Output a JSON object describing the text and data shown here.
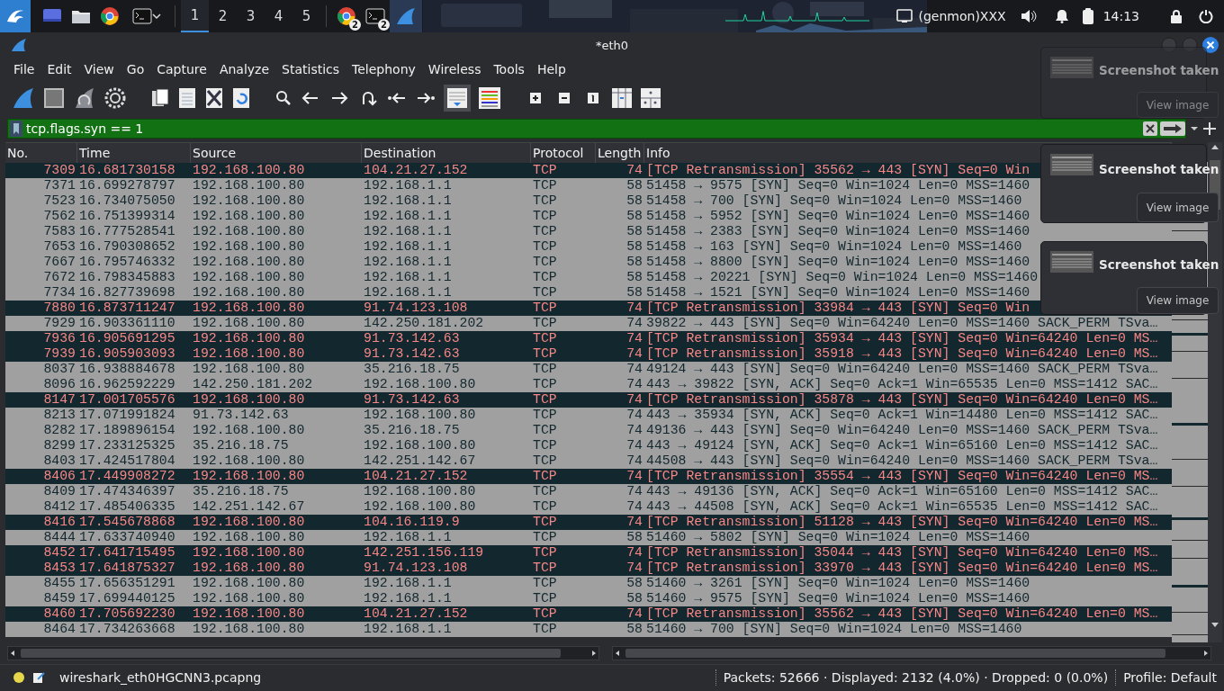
{
  "taskbar": {
    "workspaces": [
      {
        "label": "1",
        "selected": true
      },
      {
        "label": "2",
        "selected": false
      },
      {
        "label": "3",
        "selected": false
      },
      {
        "label": "4",
        "selected": false
      },
      {
        "label": "5",
        "selected": false
      }
    ],
    "app_badges": [
      "2",
      "2"
    ],
    "genmon": "(genmon)XXX",
    "clock": "14:13"
  },
  "window": {
    "title": "*eth0"
  },
  "menu": [
    "File",
    "Edit",
    "View",
    "Go",
    "Capture",
    "Analyze",
    "Statistics",
    "Telephony",
    "Wireless",
    "Tools",
    "Help"
  ],
  "filter": {
    "value": "tcp.flags.syn == 1"
  },
  "columns": [
    "No.",
    "Time",
    "Source",
    "Destination",
    "Protocol",
    "Length",
    "Info"
  ],
  "rows": [
    {
      "kind": "error",
      "cells": [
        "7309",
        "16.681730158",
        "192.168.100.80",
        "104.21.27.152",
        "TCP",
        "74",
        "[TCP Retransmission] 35562 → 443 [SYN] Seq=0 Win"
      ]
    },
    {
      "kind": "normal",
      "cells": [
        "7371",
        "16.699278797",
        "192.168.100.80",
        "192.168.1.1",
        "TCP",
        "58",
        "51458 → 9575 [SYN] Seq=0 Win=1024 Len=0 MSS=1460"
      ]
    },
    {
      "kind": "normal",
      "cells": [
        "7523",
        "16.734075050",
        "192.168.100.80",
        "192.168.1.1",
        "TCP",
        "58",
        "51458 → 700 [SYN] Seq=0 Win=1024 Len=0 MSS=1460"
      ]
    },
    {
      "kind": "normal",
      "cells": [
        "7562",
        "16.751399314",
        "192.168.100.80",
        "192.168.1.1",
        "TCP",
        "58",
        "51458 → 5952 [SYN] Seq=0 Win=1024 Len=0 MSS=1460"
      ]
    },
    {
      "kind": "normal",
      "cells": [
        "7583",
        "16.777528541",
        "192.168.100.80",
        "192.168.1.1",
        "TCP",
        "58",
        "51458 → 2383 [SYN] Seq=0 Win=1024 Len=0 MSS=1460"
      ]
    },
    {
      "kind": "normal",
      "cells": [
        "7653",
        "16.790308652",
        "192.168.100.80",
        "192.168.1.1",
        "TCP",
        "58",
        "51458 → 163 [SYN] Seq=0 Win=1024 Len=0 MSS=1460"
      ]
    },
    {
      "kind": "normal",
      "cells": [
        "7667",
        "16.795746332",
        "192.168.100.80",
        "192.168.1.1",
        "TCP",
        "58",
        "51458 → 8800 [SYN] Seq=0 Win=1024 Len=0 MSS=1460"
      ]
    },
    {
      "kind": "normal",
      "cells": [
        "7672",
        "16.798345883",
        "192.168.100.80",
        "192.168.1.1",
        "TCP",
        "58",
        "51458 → 20221 [SYN] Seq=0 Win=1024 Len=0 MSS=1460"
      ]
    },
    {
      "kind": "normal",
      "cells": [
        "7734",
        "16.827739698",
        "192.168.100.80",
        "192.168.1.1",
        "TCP",
        "58",
        "51458 → 1521 [SYN] Seq=0 Win=1024 Len=0 MSS=1460"
      ]
    },
    {
      "kind": "error",
      "cells": [
        "7880",
        "16.873711247",
        "192.168.100.80",
        "91.74.123.108",
        "TCP",
        "74",
        "[TCP Retransmission] 33984 → 443 [SYN] Seq=0 Win"
      ]
    },
    {
      "kind": "normal",
      "cells": [
        "7929",
        "16.903361110",
        "192.168.100.80",
        "142.250.181.202",
        "TCP",
        "74",
        "39822 → 443 [SYN] Seq=0 Win=64240 Len=0 MSS=1460 SACK_PERM TSva…"
      ]
    },
    {
      "kind": "error",
      "cells": [
        "7936",
        "16.905691295",
        "192.168.100.80",
        "91.73.142.63",
        "TCP",
        "74",
        "[TCP Retransmission] 35934 → 443 [SYN] Seq=0 Win=64240 Len=0 MS…"
      ]
    },
    {
      "kind": "error",
      "cells": [
        "7939",
        "16.905903093",
        "192.168.100.80",
        "91.73.142.63",
        "TCP",
        "74",
        "[TCP Retransmission] 35918 → 443 [SYN] Seq=0 Win=64240 Len=0 MS…"
      ]
    },
    {
      "kind": "normal",
      "cells": [
        "8037",
        "16.938884678",
        "192.168.100.80",
        "35.216.18.75",
        "TCP",
        "74",
        "49124 → 443 [SYN] Seq=0 Win=64240 Len=0 MSS=1460 SACK_PERM TSva…"
      ]
    },
    {
      "kind": "normal",
      "cells": [
        "8096",
        "16.962592229",
        "142.250.181.202",
        "192.168.100.80",
        "TCP",
        "74",
        "443 → 39822 [SYN, ACK] Seq=0 Ack=1 Win=65535 Len=0 MSS=1412 SAC…"
      ]
    },
    {
      "kind": "error",
      "cells": [
        "8147",
        "17.001705576",
        "192.168.100.80",
        "91.73.142.63",
        "TCP",
        "74",
        "[TCP Retransmission] 35878 → 443 [SYN] Seq=0 Win=64240 Len=0 MS…"
      ]
    },
    {
      "kind": "normal",
      "cells": [
        "8213",
        "17.071991824",
        "91.73.142.63",
        "192.168.100.80",
        "TCP",
        "74",
        "443 → 35934 [SYN, ACK] Seq=0 Ack=1 Win=14480 Len=0 MSS=1412 SAC…"
      ]
    },
    {
      "kind": "normal",
      "cells": [
        "8282",
        "17.189896154",
        "192.168.100.80",
        "35.216.18.75",
        "TCP",
        "74",
        "49136 → 443 [SYN] Seq=0 Win=64240 Len=0 MSS=1460 SACK_PERM TSva…"
      ]
    },
    {
      "kind": "normal",
      "cells": [
        "8299",
        "17.233125325",
        "35.216.18.75",
        "192.168.100.80",
        "TCP",
        "74",
        "443 → 49124 [SYN, ACK] Seq=0 Ack=1 Win=65160 Len=0 MSS=1412 SAC…"
      ]
    },
    {
      "kind": "normal",
      "cells": [
        "8403",
        "17.424517804",
        "192.168.100.80",
        "142.251.142.67",
        "TCP",
        "74",
        "44508 → 443 [SYN] Seq=0 Win=64240 Len=0 MSS=1460 SACK_PERM TSva…"
      ]
    },
    {
      "kind": "error",
      "cells": [
        "8406",
        "17.449908272",
        "192.168.100.80",
        "104.21.27.152",
        "TCP",
        "74",
        "[TCP Retransmission] 35554 → 443 [SYN] Seq=0 Win=64240 Len=0 MS…"
      ]
    },
    {
      "kind": "normal",
      "cells": [
        "8409",
        "17.474346397",
        "35.216.18.75",
        "192.168.100.80",
        "TCP",
        "74",
        "443 → 49136 [SYN, ACK] Seq=0 Ack=1 Win=65160 Len=0 MSS=1412 SAC…"
      ]
    },
    {
      "kind": "normal",
      "cells": [
        "8412",
        "17.485406335",
        "142.251.142.67",
        "192.168.100.80",
        "TCP",
        "74",
        "443 → 44508 [SYN, ACK] Seq=0 Ack=1 Win=65535 Len=0 MSS=1412 SAC…"
      ]
    },
    {
      "kind": "error",
      "cells": [
        "8416",
        "17.545678868",
        "192.168.100.80",
        "104.16.119.9",
        "TCP",
        "74",
        "[TCP Retransmission] 51128 → 443 [SYN] Seq=0 Win=64240 Len=0 MS…"
      ]
    },
    {
      "kind": "normal",
      "cells": [
        "8444",
        "17.633740940",
        "192.168.100.80",
        "192.168.1.1",
        "TCP",
        "58",
        "51460 → 5802 [SYN] Seq=0 Win=1024 Len=0 MSS=1460"
      ]
    },
    {
      "kind": "error",
      "cells": [
        "8452",
        "17.641715495",
        "192.168.100.80",
        "142.251.156.119",
        "TCP",
        "74",
        "[TCP Retransmission] 35044 → 443 [SYN] Seq=0 Win=64240 Len=0 MS…"
      ]
    },
    {
      "kind": "error",
      "cells": [
        "8453",
        "17.641875327",
        "192.168.100.80",
        "91.74.123.108",
        "TCP",
        "74",
        "[TCP Retransmission] 33970 → 443 [SYN] Seq=0 Win=64240 Len=0 MS…"
      ]
    },
    {
      "kind": "normal",
      "cells": [
        "8455",
        "17.656351291",
        "192.168.100.80",
        "192.168.1.1",
        "TCP",
        "58",
        "51460 → 3261 [SYN] Seq=0 Win=1024 Len=0 MSS=1460"
      ]
    },
    {
      "kind": "normal",
      "cells": [
        "8459",
        "17.699440125",
        "192.168.100.80",
        "192.168.1.1",
        "TCP",
        "58",
        "51460 → 9575 [SYN] Seq=0 Win=1024 Len=0 MSS=1460"
      ]
    },
    {
      "kind": "error",
      "cells": [
        "8460",
        "17.705692230",
        "192.168.100.80",
        "104.21.27.152",
        "TCP",
        "74",
        "[TCP Retransmission] 35562 → 443 [SYN] Seq=0 Win=64240 Len=0 MS…"
      ]
    },
    {
      "kind": "normal",
      "cells": [
        "8464",
        "17.734263668",
        "192.168.100.80",
        "192.168.1.1",
        "TCP",
        "58",
        "51460 → 700 [SYN] Seq=0 Win=1024 Len=0 MSS=1460"
      ]
    }
  ],
  "notifications": [
    {
      "title": "Screenshot taken",
      "button": "View image",
      "faded": true
    },
    {
      "title": "Screenshot taken",
      "button": "View image",
      "faded": false
    },
    {
      "title": "Screenshot taken",
      "button": "View image",
      "faded": false
    }
  ],
  "status_bar": {
    "file": "wireshark_eth0HGCNN3.pcapng",
    "counts": "Packets: 52666 · Displayed: 2132 (4.0%) · Dropped: 0 (0.0%)",
    "profile": "Profile: Default"
  }
}
